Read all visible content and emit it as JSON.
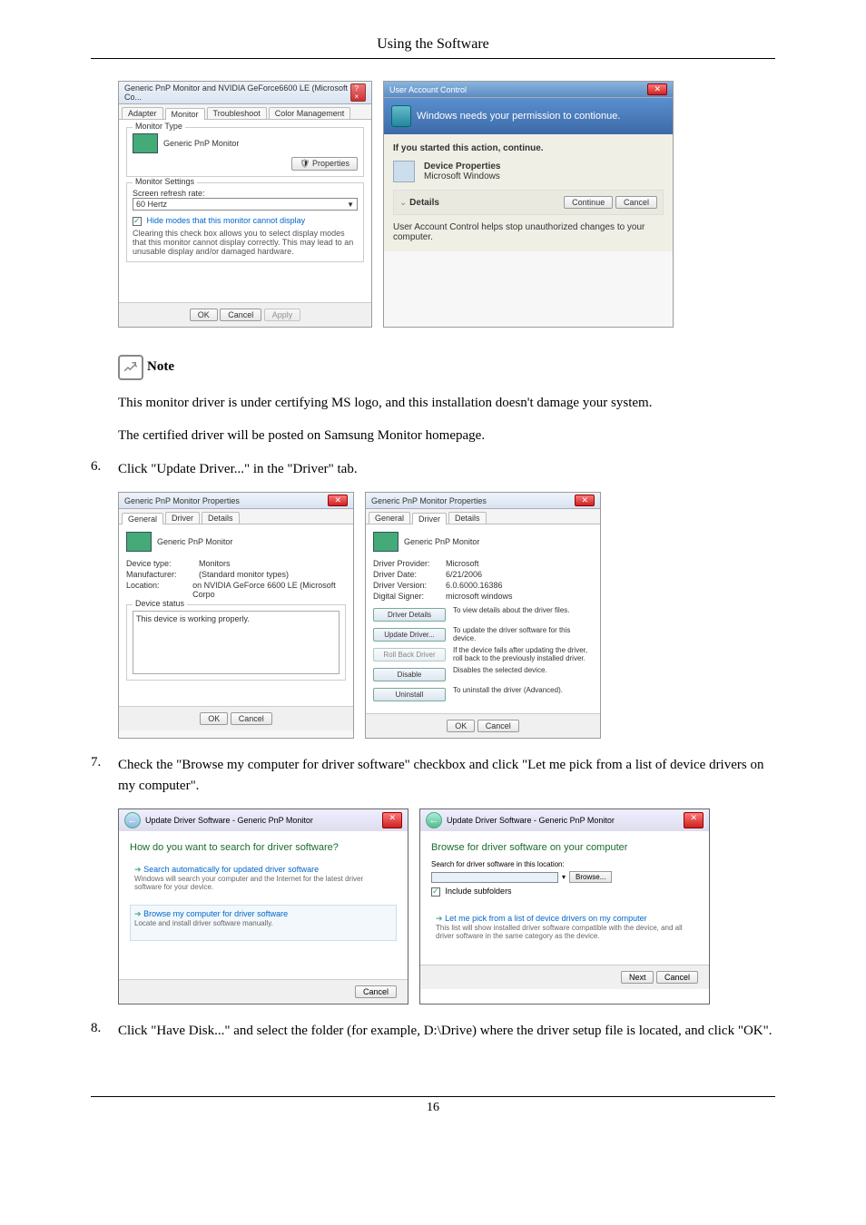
{
  "header": {
    "title": "Using the Software"
  },
  "monitor_dialog": {
    "title": "Generic PnP Monitor and NVIDIA GeForce6600 LE (Microsoft Co...",
    "tabs": {
      "t1": "Adapter",
      "t2": "Monitor",
      "t3": "Troubleshoot",
      "t4": "Color Management"
    },
    "monitor_type_group": "Monitor Type",
    "monitor_name": "Generic PnP Monitor",
    "properties_btn": "Properties",
    "settings_group": "Monitor Settings",
    "refresh_label": "Screen refresh rate:",
    "refresh_value": "60 Hertz",
    "hide_modes": "Hide modes that this monitor cannot display",
    "hide_desc": "Clearing this check box allows you to select display modes that this monitor cannot display correctly. This may lead to an unusable display and/or damaged hardware.",
    "ok": "OK",
    "cancel": "Cancel",
    "apply": "Apply"
  },
  "uac": {
    "title": "User Account Control",
    "banner": "Windows needs your permission to contionue.",
    "started": "If you started this action, continue.",
    "prop_name": "Device Properties",
    "prop_pub": "Microsoft Windows",
    "details": "Details",
    "continue": "Continue",
    "cancel": "Cancel",
    "help": "User Account Control helps stop unauthorized changes to your computer."
  },
  "note": {
    "label": "Note",
    "line1": "This monitor driver is under certifying MS logo, and this installation doesn't damage your system.",
    "line2": "The certified driver will be posted on Samsung Monitor homepage."
  },
  "step6": {
    "num": "6.",
    "text": "Click \"Update Driver...\" in the \"Driver\" tab."
  },
  "props_general": {
    "title": "Generic PnP Monitor Properties",
    "tabs": {
      "t1": "General",
      "t2": "Driver",
      "t3": "Details"
    },
    "name": "Generic PnP Monitor",
    "device_type_k": "Device type:",
    "device_type_v": "Monitors",
    "manuf_k": "Manufacturer:",
    "manuf_v": "(Standard monitor types)",
    "loc_k": "Location:",
    "loc_v": "on NVIDIA GeForce 6600 LE (Microsoft Corpo",
    "status_group": "Device status",
    "status_text": "This device is working properly.",
    "ok": "OK",
    "cancel": "Cancel"
  },
  "props_driver": {
    "title": "Generic PnP Monitor Properties",
    "tabs": {
      "t1": "General",
      "t2": "Driver",
      "t3": "Details"
    },
    "name": "Generic PnP Monitor",
    "provider_k": "Driver Provider:",
    "provider_v": "Microsoft",
    "date_k": "Driver Date:",
    "date_v": "6/21/2006",
    "version_k": "Driver Version:",
    "version_v": "6.0.6000.16386",
    "signer_k": "Digital Signer:",
    "signer_v": "microsoft windows",
    "b1": "Driver Details",
    "d1": "To view details about the driver files.",
    "b2": "Update Driver...",
    "d2": "To update the driver software for this device.",
    "b3": "Roll Back Driver",
    "d3": "If the device fails after updating the driver, roll back to the previously installed driver.",
    "b4": "Disable",
    "d4": "Disables the selected device.",
    "b5": "Uninstall",
    "d5": "To uninstall the driver (Advanced).",
    "ok": "OK",
    "cancel": "Cancel"
  },
  "step7": {
    "num": "7.",
    "text": "Check the \"Browse my computer for driver software\" checkbox and click \"Let me pick from a list of device drivers on my computer\"."
  },
  "wizard1": {
    "title": "Update Driver Software - Generic PnP Monitor",
    "heading": "How do you want to search for driver software?",
    "opt1": "Search automatically for updated driver software",
    "opt1d": "Windows will search your computer and the Internet for the latest driver software for your device.",
    "opt2": "Browse my computer for driver software",
    "opt2d": "Locate and install driver software manually.",
    "cancel": "Cancel"
  },
  "wizard2": {
    "title": "Update Driver Software - Generic PnP Monitor",
    "heading": "Browse for driver software on your computer",
    "search_label": "Search for driver software in this location:",
    "browse": "Browse...",
    "include": "Include subfolders",
    "pick": "Let me pick from a list of device drivers on my computer",
    "pickd": "This list will show installed driver software compatible with the device, and all driver software in the same category as the device.",
    "next": "Next",
    "cancel": "Cancel"
  },
  "step8": {
    "num": "8.",
    "text": "Click \"Have Disk...\" and select the folder (for example, D:\\Drive) where the driver setup file is located, and click \"OK\"."
  },
  "footer": {
    "page": "16"
  }
}
